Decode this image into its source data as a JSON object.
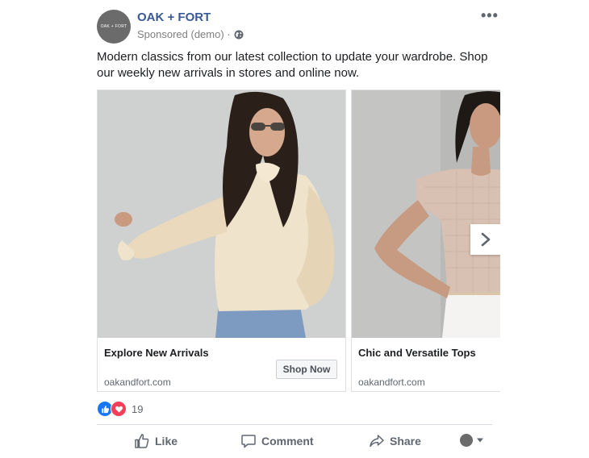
{
  "post": {
    "page_name": "OAK + FORT",
    "avatar_text": "OAK + FORT",
    "sponsored": "Sponsored (demo) ·",
    "body": "Modern classics from our latest collection to update your wardrobe. Shop our weekly new arrivals in stores and online now.",
    "more_icon": "•••"
  },
  "carousel": {
    "cards": [
      {
        "title": "Explore New Arrivals",
        "domain": "oakandfort.com",
        "cta": "Shop Now"
      },
      {
        "title": "Chic and Versatile Tops",
        "domain": "oakandfort.com"
      }
    ]
  },
  "reactions": {
    "count": "19"
  },
  "actions": {
    "like": "Like",
    "comment": "Comment",
    "share": "Share"
  },
  "colors": {
    "brand": "#385898",
    "like": "#1877f2",
    "love": "#f33e58"
  }
}
